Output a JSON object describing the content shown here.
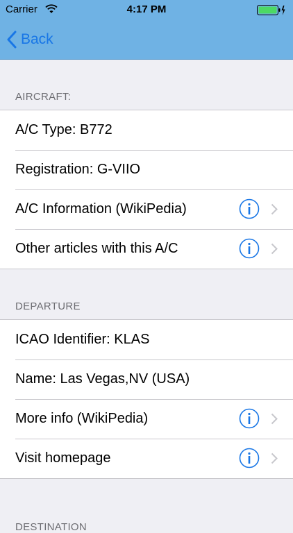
{
  "status_bar": {
    "carrier": "Carrier",
    "time": "4:17 PM"
  },
  "nav": {
    "back_label": "Back"
  },
  "sections": [
    {
      "header": "AIRCRAFT:",
      "rows": [
        {
          "label": "A/C Type: B772",
          "accessory": false
        },
        {
          "label": "Registration: G-VIIO",
          "accessory": false
        },
        {
          "label": "A/C Information (WikiPedia)",
          "accessory": true
        },
        {
          "label": "Other articles with this A/C",
          "accessory": true
        }
      ]
    },
    {
      "header": "DEPARTURE",
      "rows": [
        {
          "label": "ICAO Identifier: KLAS",
          "accessory": false
        },
        {
          "label": "Name: Las Vegas,NV (USA)",
          "accessory": false
        },
        {
          "label": "More info (WikiPedia)",
          "accessory": true
        },
        {
          "label": "Visit homepage",
          "accessory": true
        }
      ]
    },
    {
      "header": "DESTINATION"
    }
  ],
  "colors": {
    "nav_bar": "#6fb2e4",
    "tint": "#1876e6",
    "background": "#efeff4"
  }
}
